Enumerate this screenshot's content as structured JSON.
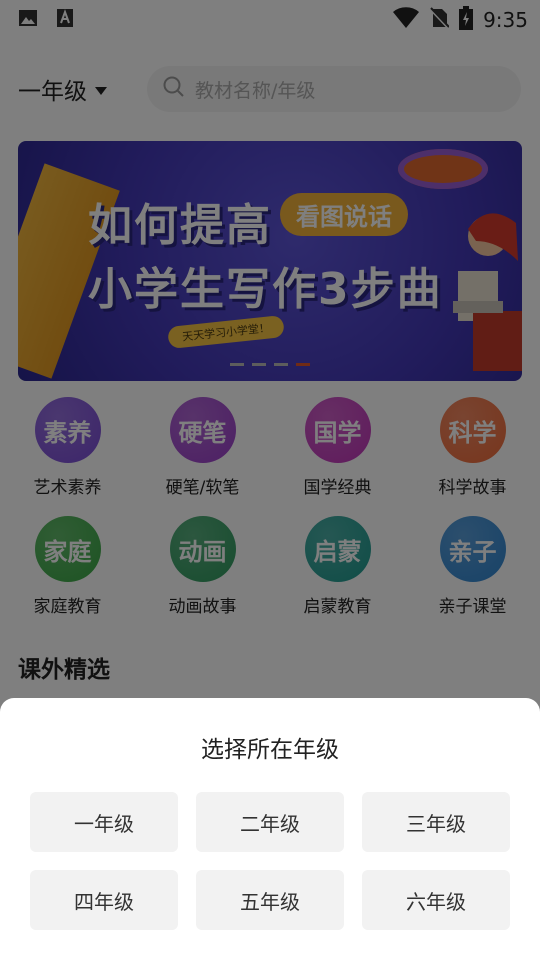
{
  "status_bar": {
    "time": "9:35",
    "icons": [
      "image-icon",
      "text-a-icon",
      "wifi-icon",
      "no-sim-icon",
      "battery-charging-icon"
    ]
  },
  "header": {
    "grade": "一年级",
    "search_placeholder": "教材名称/年级"
  },
  "banner": {
    "line1": "如何提高",
    "bubble": "看图说话",
    "line2": "小学生写作3步曲",
    "tag": "天天学习小学堂！",
    "page_count": 4,
    "active_page": 4
  },
  "categories": [
    {
      "icon_text": "素养",
      "label": "艺术素养",
      "color": "#7a4bd6"
    },
    {
      "icon_text": "硬笔",
      "label": "硬笔/软笔",
      "color": "#9b3fc9"
    },
    {
      "icon_text": "国学",
      "label": "国学经典",
      "color": "#c035b9"
    },
    {
      "icon_text": "科学",
      "label": "科学故事",
      "color": "#ef6b3a"
    },
    {
      "icon_text": "家庭",
      "label": "家庭教育",
      "color": "#3aa845"
    },
    {
      "icon_text": "动画",
      "label": "动画故事",
      "color": "#2f9a5e"
    },
    {
      "icon_text": "启蒙",
      "label": "启蒙教育",
      "color": "#1e9a8f"
    },
    {
      "icon_text": "亲子",
      "label": "亲子课堂",
      "color": "#2f85d0"
    }
  ],
  "section_title": "课外精选",
  "sheet": {
    "title": "选择所在年级",
    "options": [
      "一年级",
      "二年级",
      "三年级",
      "四年级",
      "五年级",
      "六年级"
    ]
  }
}
